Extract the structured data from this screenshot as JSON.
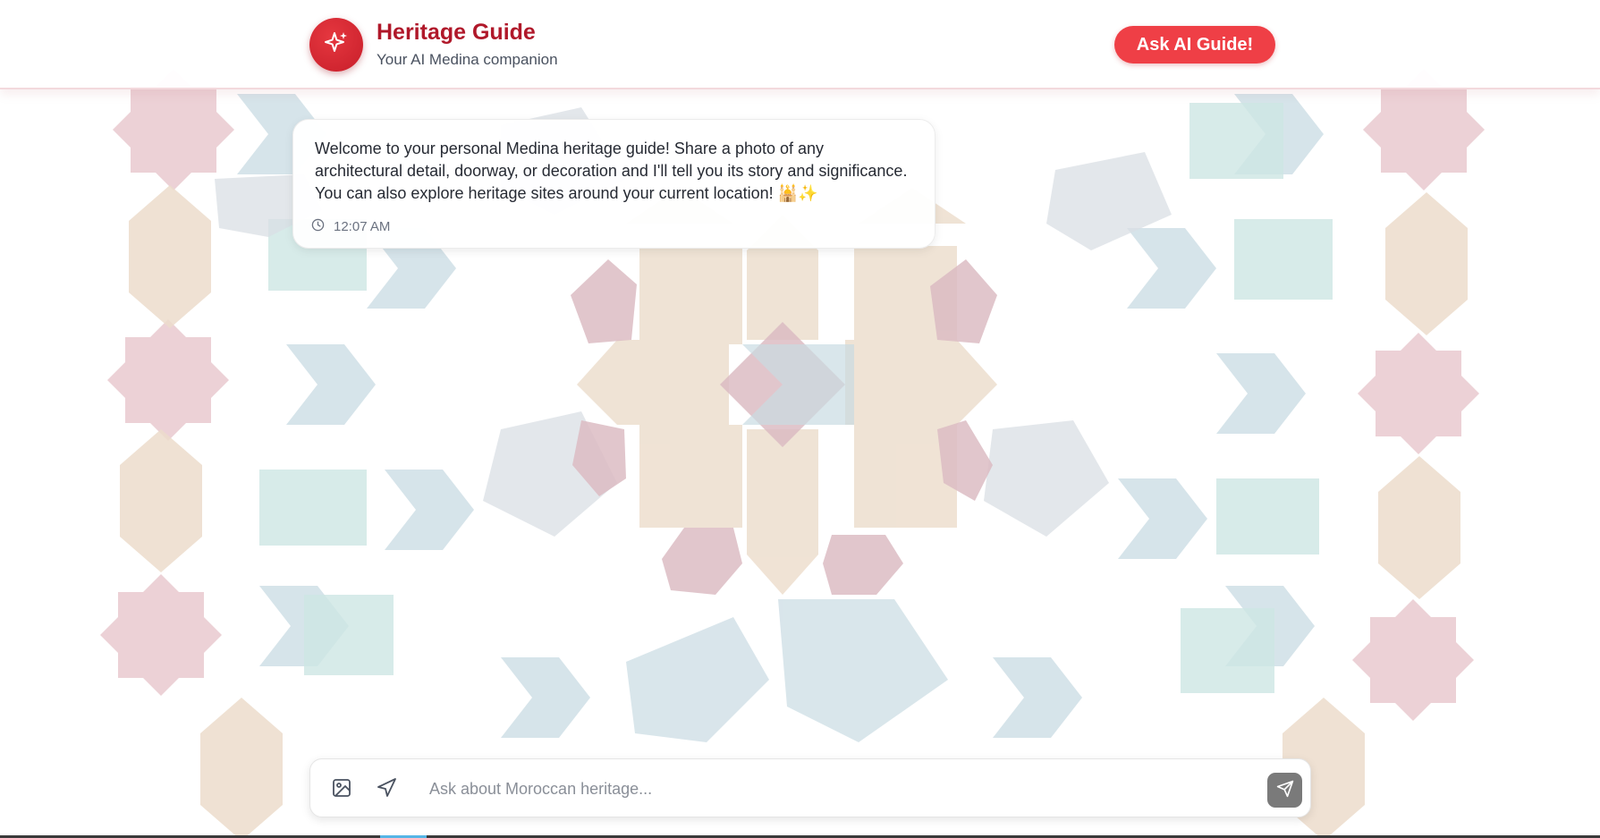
{
  "header": {
    "title": "Heritage Guide",
    "subtitle": "Your AI Medina companion",
    "ask_button_label": "Ask AI Guide!",
    "logo_icon": "sparkles-icon"
  },
  "messages": [
    {
      "text": "Welcome to your personal Medina heritage guide! Share a photo of any architectural detail, doorway, or decoration and I'll tell you its story and significance. You can also explore heritage sites around your current location! 🕌✨",
      "time": "12:07 AM",
      "time_icon": "clock-icon"
    }
  ],
  "composer": {
    "placeholder": "Ask about Moroccan heritage...",
    "value": "",
    "image_icon": "image-icon",
    "location_icon": "navigation-arrow-icon",
    "send_icon": "send-icon"
  },
  "colors": {
    "brand_red": "#b0182a",
    "button_red": "#ef3f46",
    "send_gray": "#7a7a7a",
    "tile_pink": "#e8c6cc",
    "tile_blue": "#c9dbe3",
    "tile_beige": "#ecdccb",
    "tile_mint": "#cde6e4"
  }
}
